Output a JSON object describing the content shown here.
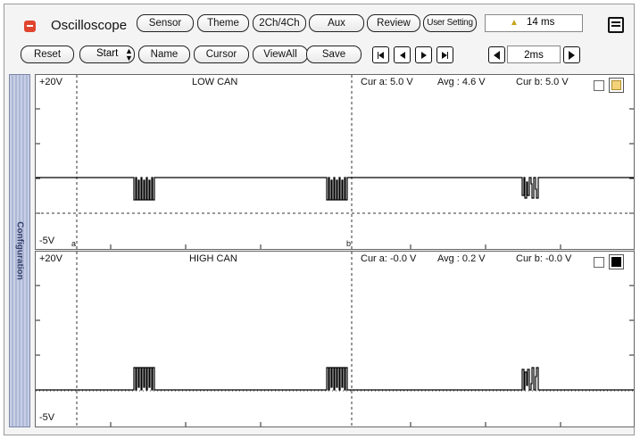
{
  "app": {
    "title": "Oscilloscope"
  },
  "toolbar1": {
    "sensor": "Sensor",
    "theme": "Theme",
    "channels": "2Ch/4Ch",
    "aux": "Aux",
    "review": "Review",
    "user_setting": "User Setting",
    "time_value": "14 ms"
  },
  "toolbar2": {
    "reset": "Reset",
    "start": "Start",
    "name": "Name",
    "cursor": "Cursor",
    "viewall": "ViewAll",
    "save": "Save",
    "timebase": "2ms"
  },
  "sidebar": {
    "label": "Configuration"
  },
  "channels": [
    {
      "title": "LOW CAN",
      "vmax": "+20V",
      "vmin": "-5V",
      "cur_a": "Cur a: 5.0 V",
      "avg": "Avg  : 4.6 V",
      "cur_b": "Cur b: 5.0 V",
      "cursor_a_label": "a",
      "cursor_b_label": "b"
    },
    {
      "title": "HIGH CAN",
      "vmax": "+20V",
      "vmin": "-5V",
      "cur_a": "Cur a: -0.0 V",
      "avg": "Avg  : 0.2 V",
      "cur_b": "Cur b: -0.0 V"
    }
  ],
  "colors": {
    "accent": "#e0452f",
    "trace": "#000000",
    "toggle_fill": "#f3d27a"
  }
}
